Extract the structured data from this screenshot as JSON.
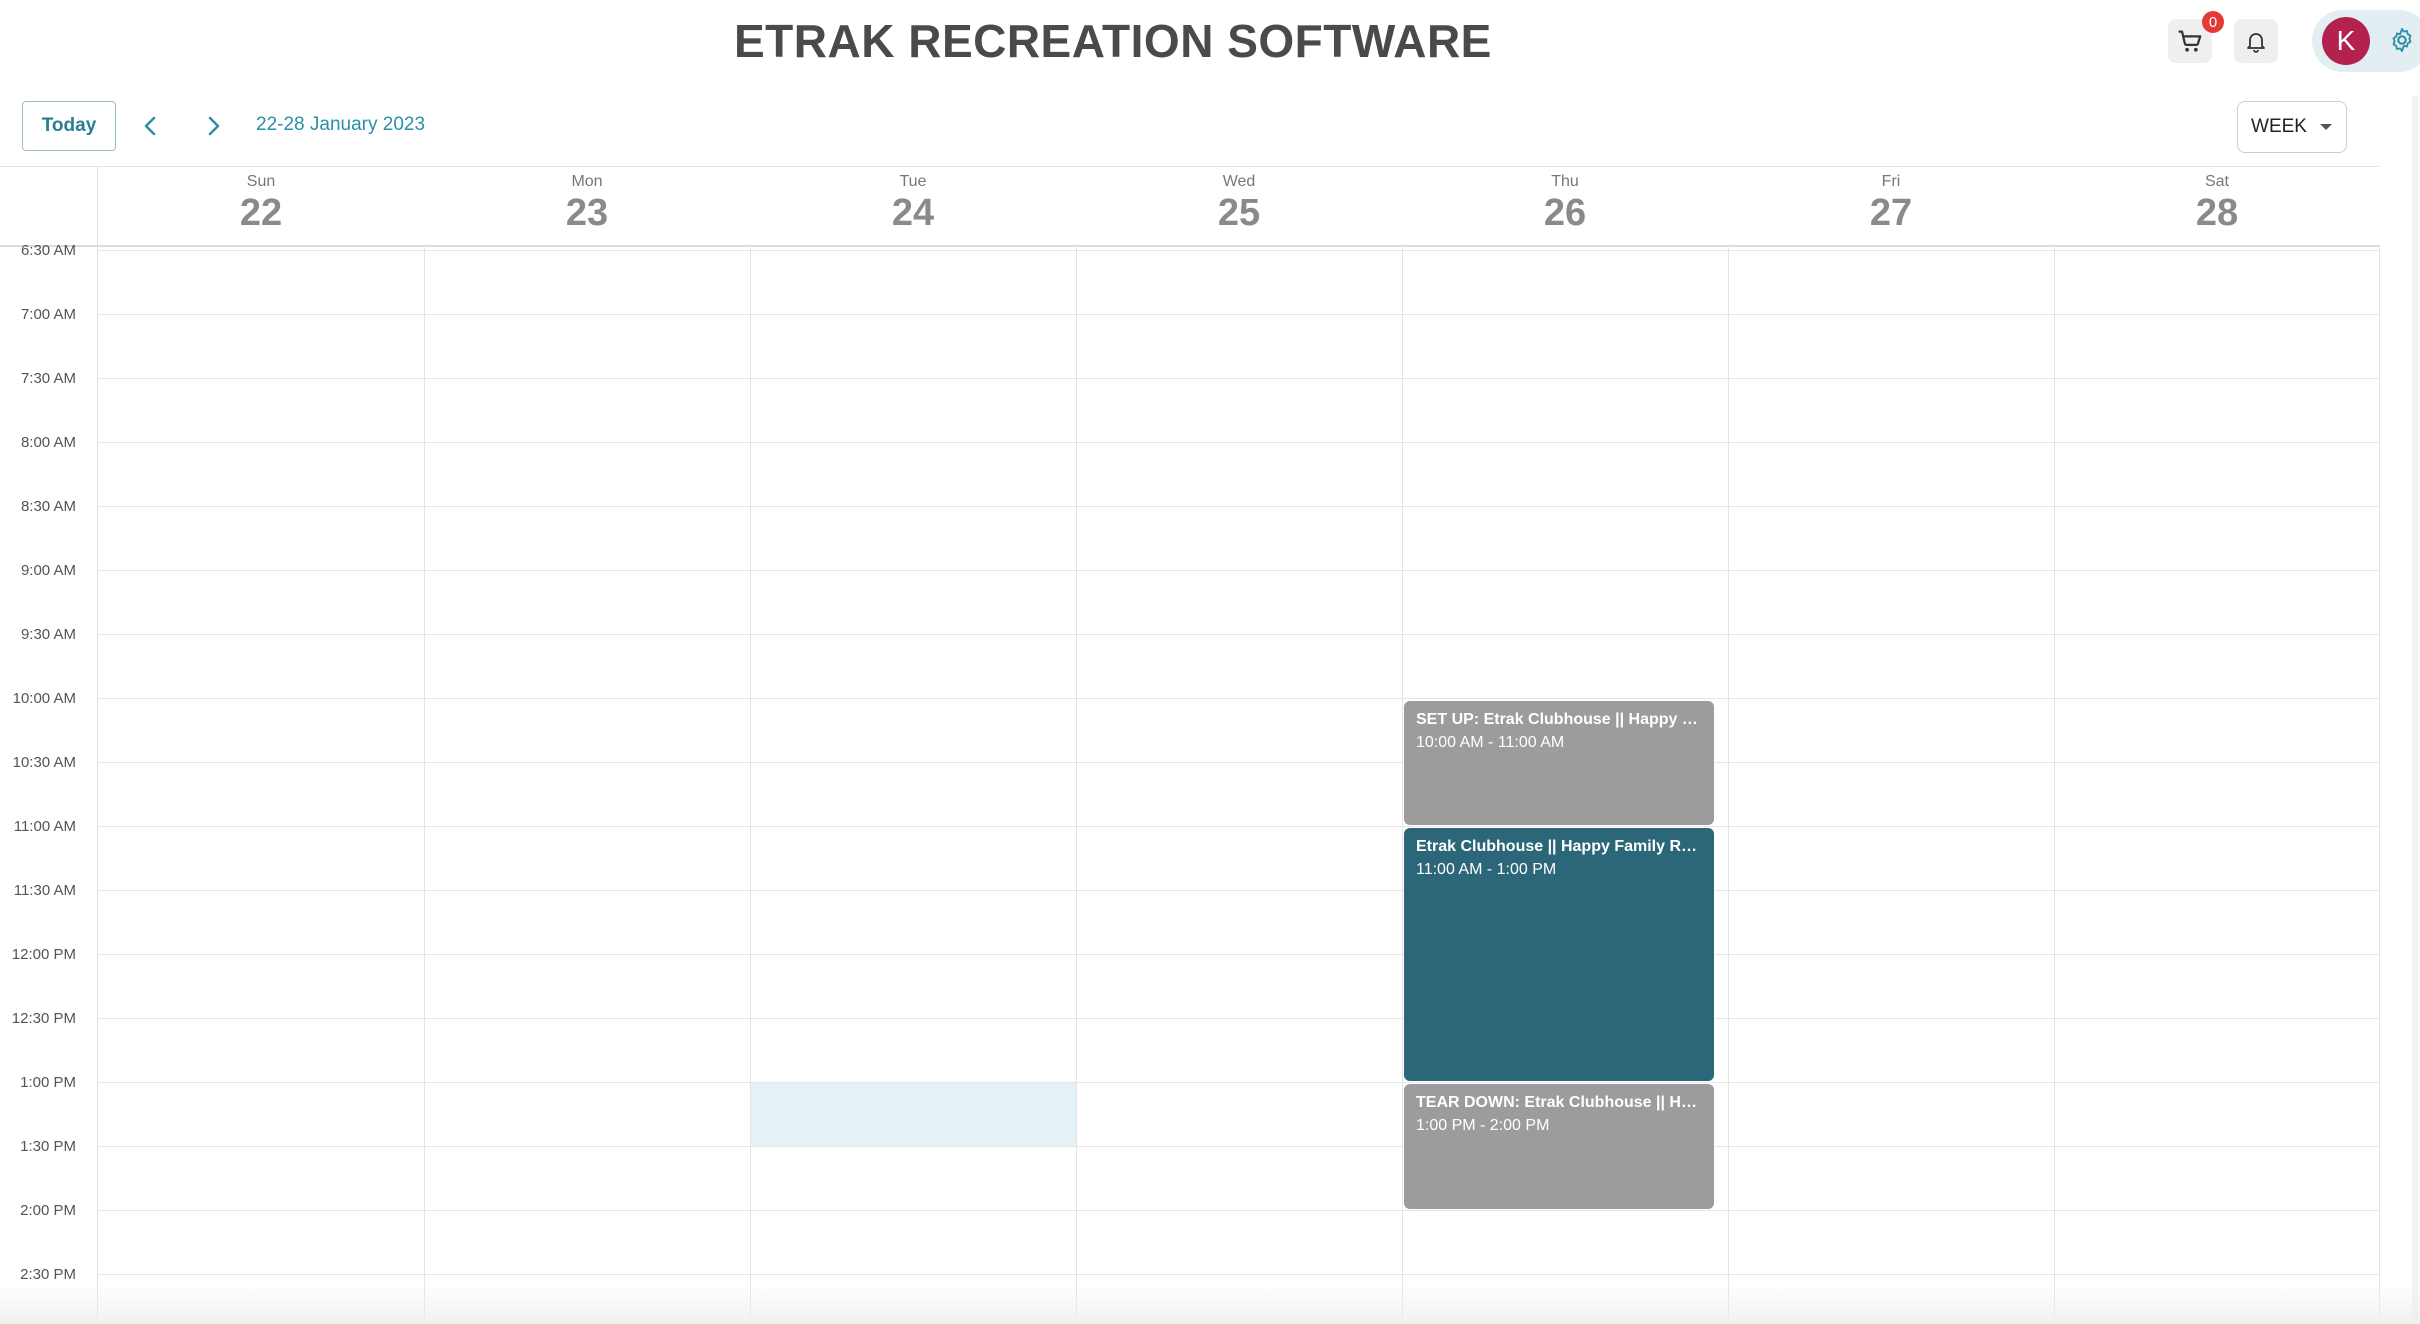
{
  "header": {
    "title": "ETRAK RECREATION SOFTWARE",
    "cart_count": "0",
    "avatar_initial": "K",
    "icons": {
      "cart": "shopping-cart-icon",
      "bell": "bell-icon",
      "settings": "gear-icon"
    }
  },
  "toolbar": {
    "today_label": "Today",
    "date_range": "22-28 January 2023",
    "view_label": "WEEK"
  },
  "days": [
    {
      "name": "Sun",
      "number": "22"
    },
    {
      "name": "Mon",
      "number": "23"
    },
    {
      "name": "Tue",
      "number": "24"
    },
    {
      "name": "Wed",
      "number": "25"
    },
    {
      "name": "Thu",
      "number": "26"
    },
    {
      "name": "Fri",
      "number": "27"
    },
    {
      "name": "Sat",
      "number": "28"
    }
  ],
  "times": [
    "6:30 AM",
    "7:00 AM",
    "7:30 AM",
    "8:00 AM",
    "8:30 AM",
    "9:00 AM",
    "9:30 AM",
    "10:00 AM",
    "10:30 AM",
    "11:00 AM",
    "11:30 AM",
    "12:00 PM",
    "12:30 PM",
    "1:00 PM",
    "1:30 PM",
    "2:00 PM",
    "2:30 PM"
  ],
  "events": [
    {
      "title": "SET UP: Etrak Clubhouse || Happy Fa...",
      "time": "10:00 AM  -  11:00 AM"
    },
    {
      "title": "Etrak Clubhouse || Happy Family Rese...",
      "time": "11:00 AM  -  1:00 PM"
    },
    {
      "title": "TEAR DOWN: Etrak Clubhouse || Happ...",
      "time": "1:00 PM  -  2:00 PM"
    }
  ],
  "colors": {
    "accent": "#2a90a8",
    "event_teal": "#2c6679",
    "event_gray": "#9c9c9c",
    "badge": "#e53935",
    "avatar": "#b3214f"
  }
}
